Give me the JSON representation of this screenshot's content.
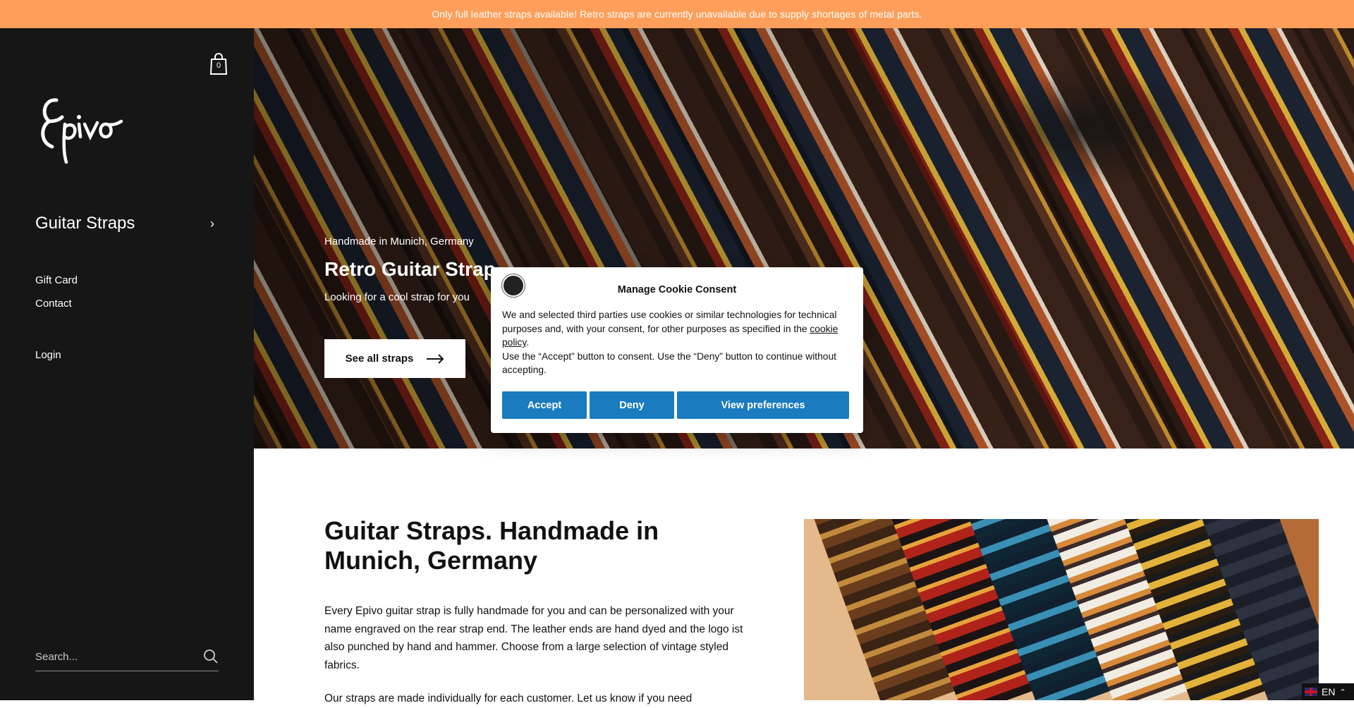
{
  "announcement": "Only full leather straps available! Retro straps are currently unavailable due to supply shortages of metal parts.",
  "sidebar": {
    "cart_count": "0",
    "nav_primary": "Guitar Straps",
    "links": [
      "Gift Card",
      "Contact",
      "Login"
    ],
    "search_placeholder": "Search..."
  },
  "hero": {
    "kicker": "Handmade in Munich, Germany",
    "title": "Retro Guitar Strap",
    "subtitle": "Looking for a cool strap for you",
    "button_label": "See all straps"
  },
  "intro": {
    "title": "Guitar Straps. Handmade in Munich, Germany",
    "paragraph1": "Every Epivo guitar strap is fully handmade for you and can be personalized with your name engraved on the rear strap end. The leather ends are hand dyed and the logo ist also punched by hand and hammer. Choose from a large selection of vintage styled fabrics.",
    "paragraph2": "Our straps are made individually for each customer. Let us know if you need"
  },
  "cookie": {
    "title": "Manage Cookie Consent",
    "text1": "We and selected third parties use cookies or similar technologies for technical purposes and, with your consent, for other purposes as specified in the",
    "link": "cookie policy",
    "text1_end": ".",
    "text2": "Use the “Accept” button to consent. Use the “Deny” button to continue without accepting.",
    "accept": "Accept",
    "deny": "Deny",
    "preferences": "View preferences"
  },
  "language": "EN",
  "colors": {
    "announcement_bg": "#fd9f5a",
    "sidebar_bg": "#161616",
    "cookie_button": "#1a7bbf"
  }
}
